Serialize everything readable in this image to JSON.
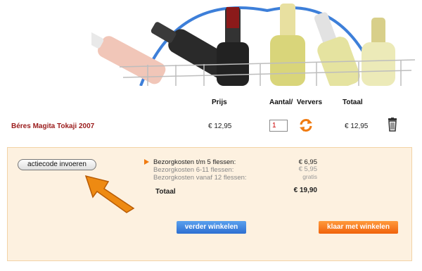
{
  "table": {
    "headers": {
      "price": "Prijs",
      "quantity": "Aantal/",
      "refresh": "Ververs",
      "total": "Totaal"
    }
  },
  "cart": {
    "items": [
      {
        "name": "Béres Magita Tokaji 2007",
        "price": "€ 12,95",
        "quantity": "1",
        "total": "€ 12,95"
      }
    ]
  },
  "summary": {
    "promo_button": "actiecode invoeren",
    "shipping": [
      {
        "label": "Bezorgkosten t/m 5 flessen:",
        "value": "€ 6,95"
      },
      {
        "label": "Bezorgkosten 6-11 flessen:",
        "value": "€ 5,95"
      },
      {
        "label": "Bezorgkosten vanaf 12 flessen:",
        "value": "gratis"
      }
    ],
    "total_label": "Totaal",
    "total_value": "€ 19,90"
  },
  "actions": {
    "continue_label": "verder winkelen",
    "checkout_label": "klaar met winkelen"
  },
  "colors": {
    "product_name": "#9a1b1b",
    "accent_orange": "#f07b10",
    "continue_blue": "#2d6fd1",
    "panel_background": "#fdf1e0"
  }
}
